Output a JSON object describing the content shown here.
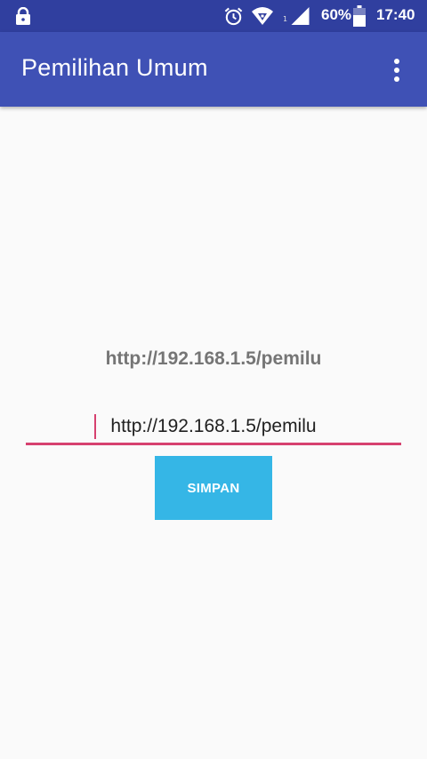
{
  "status_bar": {
    "sim_label": "1",
    "battery_percent": "60%",
    "time": "17:40",
    "icons": [
      "lock-icon",
      "alarm-icon",
      "wifi-icon",
      "signal-icon",
      "battery-icon"
    ]
  },
  "app_bar": {
    "title": "Pemilihan Umum",
    "menu_icon": "more-vert-icon"
  },
  "main": {
    "current_url_label": "http://192.168.1.5/pemilu",
    "url_input_value": "http://192.168.1.5/pemilu",
    "save_button_label": "SIMPAN"
  },
  "colors": {
    "status_bar": "#303f9f",
    "app_bar": "#3f51b5",
    "accent": "#d6416f",
    "button": "#35b6e6",
    "background": "#fafafa"
  }
}
